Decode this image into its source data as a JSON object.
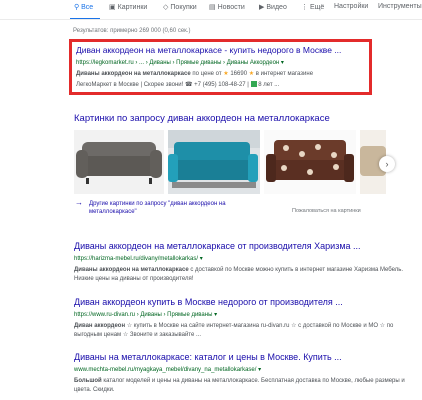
{
  "tabs": [
    {
      "icon": "⚲",
      "label": "Все"
    },
    {
      "icon": "▣",
      "label": "Картинки"
    },
    {
      "icon": "◇",
      "label": "Покупки"
    },
    {
      "icon": "▤",
      "label": "Новости"
    },
    {
      "icon": "▶",
      "label": "Видео"
    },
    {
      "icon": "⋮",
      "label": "Ещё"
    },
    {
      "label": "Настройки"
    },
    {
      "label": "Инструменты"
    }
  ],
  "stats": "Результатов: примерно 269 000 (0,60 сек.)",
  "ad": {
    "title": "Диван аккордеон на металлокаркасе - купить недорого в Москве ...",
    "url": "https://legkomarket.ru › ... › Диваны › Прямые диваны › Диваны Аккордеон",
    "desc_bold": "Диваны аккордеон на металлокаркасе",
    "desc_rest": " по цене от ",
    "rating": "16690",
    "desc_tail": " в интернет магазине",
    "extra": "ЛегкоМаркет в Москве | Скорее звони! ☎ +7 (495) 108-48-27 |",
    "extra_tail": "8 лет ..."
  },
  "images": {
    "heading": "Картинки по запросу диван аккордеон на металлокаркасе",
    "more_label": "Другие картинки по запросу \"диван аккордеон на металлокаркасе\"",
    "feedback": "Пожаловаться на картинки",
    "next_icon": "›"
  },
  "results": [
    {
      "title": "Диваны аккордеон на металлокаркасе от производителя Харизма ...",
      "url": "https://harizma-mebel.ru/divany/metallokarkas/",
      "snippet_bold": "Диваны аккордеон на металлокаркасе",
      "snippet": " с доставкой по Москве можно купить в интернет магазине Харизма Мебель. Низкие цены на диваны от производителя!"
    },
    {
      "title": "Диван аккордеон купить в Москве недорого от производителя ...",
      "url": "https://www.ru-divan.ru › Диваны › Прямые диваны",
      "snippet_bold": "Диван аккордеон",
      "snippet": " ☆ купить в Москве на сайте интернет-магазина ru-divan.ru ☆ с доставкой по Москве и МО ☆ по выгодным ценам ☆ Звоните и заказывайте ..."
    },
    {
      "title": "Диваны на металлокаркасе: каталог и цены в Москве. Купить ...",
      "url": "www.mechta-mebel.ru/myagkaya_mebel/divany_na_metallokarkase/",
      "snippet_bold": "Большой",
      "snippet": " каталог моделей и цены на диваны на металлокаркасе. Бесплатная доставка по Москве, любые размеры и цвета. Скидки."
    }
  ]
}
